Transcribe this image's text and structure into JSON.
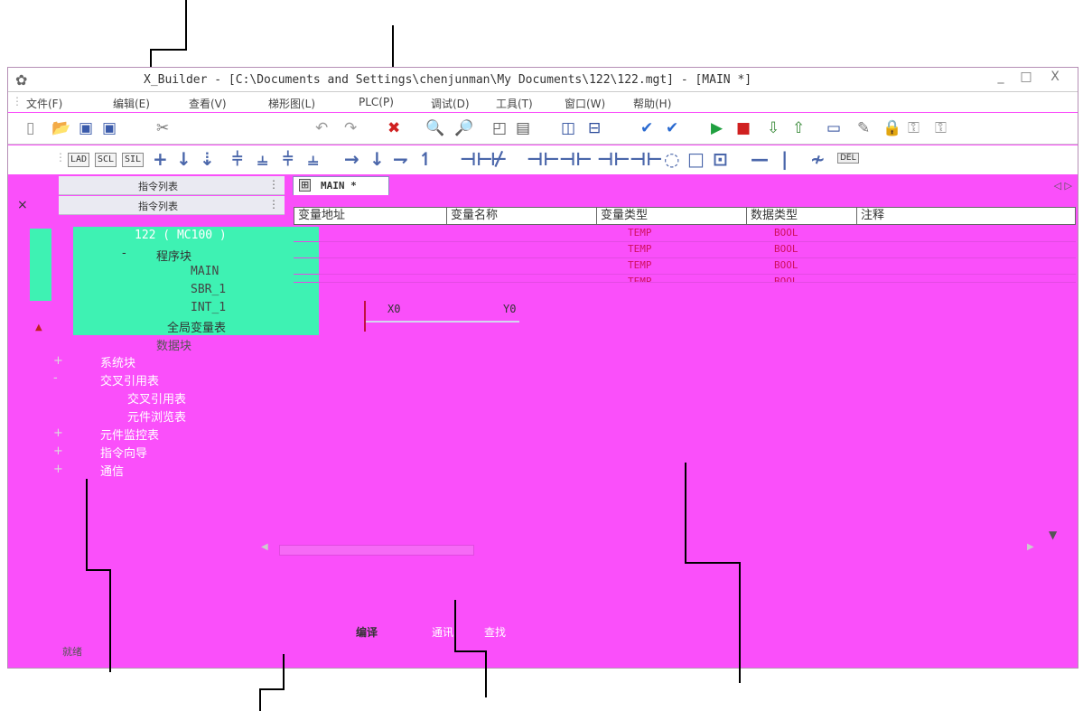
{
  "window": {
    "title": "X_Builder - [C:\\Documents and Settings\\chenjunman\\My Documents\\122\\122.mgt] - [MAIN *]",
    "minimize": "_",
    "maximize": "□",
    "close": "X"
  },
  "menu": [
    {
      "label": "文件(F)"
    },
    {
      "label": "编辑(E)"
    },
    {
      "label": "查看(V)"
    },
    {
      "label": "梯形图(L)"
    },
    {
      "label": "PLC(P)"
    },
    {
      "label": "调试(D)"
    },
    {
      "label": "工具(T)"
    },
    {
      "label": "窗口(W)"
    },
    {
      "label": "帮助(H)"
    }
  ],
  "toolbar2_buttons": [
    "LAD",
    "SCL",
    "SIL"
  ],
  "left_panel": {
    "title": "指令列表",
    "title2": "指令列表",
    "close": "×"
  },
  "tree": {
    "root": "122 ( MC100 )",
    "program_block": "程序块",
    "main": "MAIN",
    "sbr1": "SBR_1",
    "int1": "INT_1",
    "global_vars": "全局变量表",
    "data_block": "数据块",
    "system_block": "系统块",
    "cross_ref": "交叉引用表",
    "cross_ref_sub": "交叉引用表",
    "element_browse": "元件浏览表",
    "monitor": "元件监控表",
    "wizard": "指令向导",
    "comm": "通信",
    "plus": "+",
    "minus": "-"
  },
  "editor": {
    "tab_label": "MAIN *",
    "tab_nav": "◁ ▷",
    "columns": [
      "变量地址",
      "变量名称",
      "变量类型",
      "数据类型",
      "注释"
    ],
    "rows": [
      {
        "var_type": "TEMP",
        "data_type": "BOOL"
      },
      {
        "var_type": "TEMP",
        "data_type": "BOOL"
      },
      {
        "var_type": "TEMP",
        "data_type": "BOOL"
      },
      {
        "var_type": "TEMP",
        "data_type": "BOOL"
      }
    ],
    "rung_x0": "X0",
    "rung_y0": "Y0"
  },
  "output_tabs": [
    "编译",
    "通讯",
    "查找"
  ],
  "status": {
    "text": "就绪"
  },
  "colors": {
    "background_magenta": "#fa4ffa",
    "tree_highlight": "#3ef2b3",
    "row_text": "#d01060"
  }
}
